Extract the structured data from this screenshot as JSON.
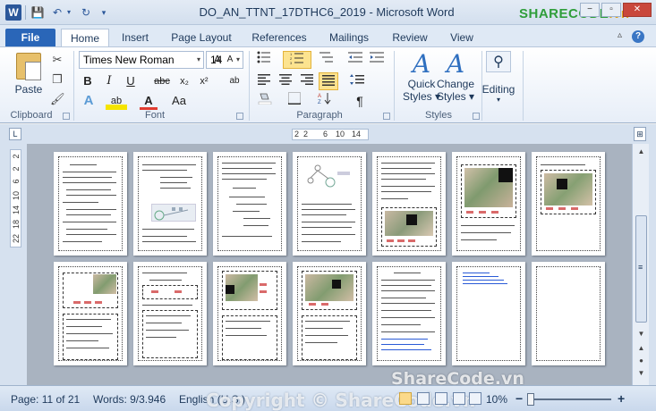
{
  "app": {
    "title": "DO_AN_TTNT_17DTHC6_2019  -  Microsoft Word",
    "word_icon": "W",
    "brand": {
      "text": "SHARECODE",
      "suffix": ".vn"
    }
  },
  "quick_access": {
    "save_icon": "💾",
    "undo_icon": "↶",
    "redo_icon": "↻",
    "separator": "|",
    "dropdown": "▾"
  },
  "window_buttons": {
    "minimize": "−",
    "restore": "▫",
    "close": "✕",
    "help": "?",
    "collapse": "▵"
  },
  "tabs": [
    {
      "label": "File"
    },
    {
      "label": "Home"
    },
    {
      "label": "Insert"
    },
    {
      "label": "Page Layout"
    },
    {
      "label": "References"
    },
    {
      "label": "Mailings"
    },
    {
      "label": "Review"
    },
    {
      "label": "View"
    }
  ],
  "ribbon": {
    "clipboard": {
      "label": "Clipboard",
      "paste": "Paste",
      "cut_icon": "✂",
      "copy_icon": "❐",
      "painter_icon": "🖌"
    },
    "font": {
      "label": "Font",
      "font_name": "Times New Roman",
      "font_size": "14",
      "grow": "A",
      "shrink": "A",
      "clear_icon": "⌫",
      "bold": "B",
      "italic": "I",
      "underline": "U",
      "strike": "abc",
      "subscript": "x₂",
      "superscript": "x²",
      "phonetic_icon": "ab",
      "text_effects": "A",
      "highlight": "ab",
      "font_color": "A",
      "change_case": "Aa"
    },
    "paragraph": {
      "label": "Paragraph",
      "show_marks": "¶"
    },
    "styles": {
      "label": "Styles",
      "quick_styles": [
        "Quick",
        "Styles ▾"
      ],
      "change_styles": [
        "Change",
        "Styles ▾"
      ]
    },
    "editing": {
      "label": "Editing",
      "dropdown": "▾"
    }
  },
  "ruler": {
    "corner": "L",
    "ticks": [
      "2",
      "2",
      "6",
      "10",
      "14"
    ],
    "vertical_ticks": [
      "2",
      "2",
      "6",
      "10",
      "14",
      "18",
      "22"
    ],
    "right_icon": "⊞"
  },
  "scrollbar": {
    "up": "▲",
    "down": "▼",
    "prev_page": "▲",
    "select_browse": "●",
    "next_page": "▼",
    "grip": "≡"
  },
  "status": {
    "page": "Page: 11 of 21",
    "words": "Words: 9/3.946",
    "language": "English (U.S.)",
    "zoom": "10%",
    "zoom_out": "−",
    "zoom_in": "+"
  },
  "watermarks": {
    "status": "Copyright © ShareCode.vn",
    "doc": "ShareCode.vn"
  }
}
